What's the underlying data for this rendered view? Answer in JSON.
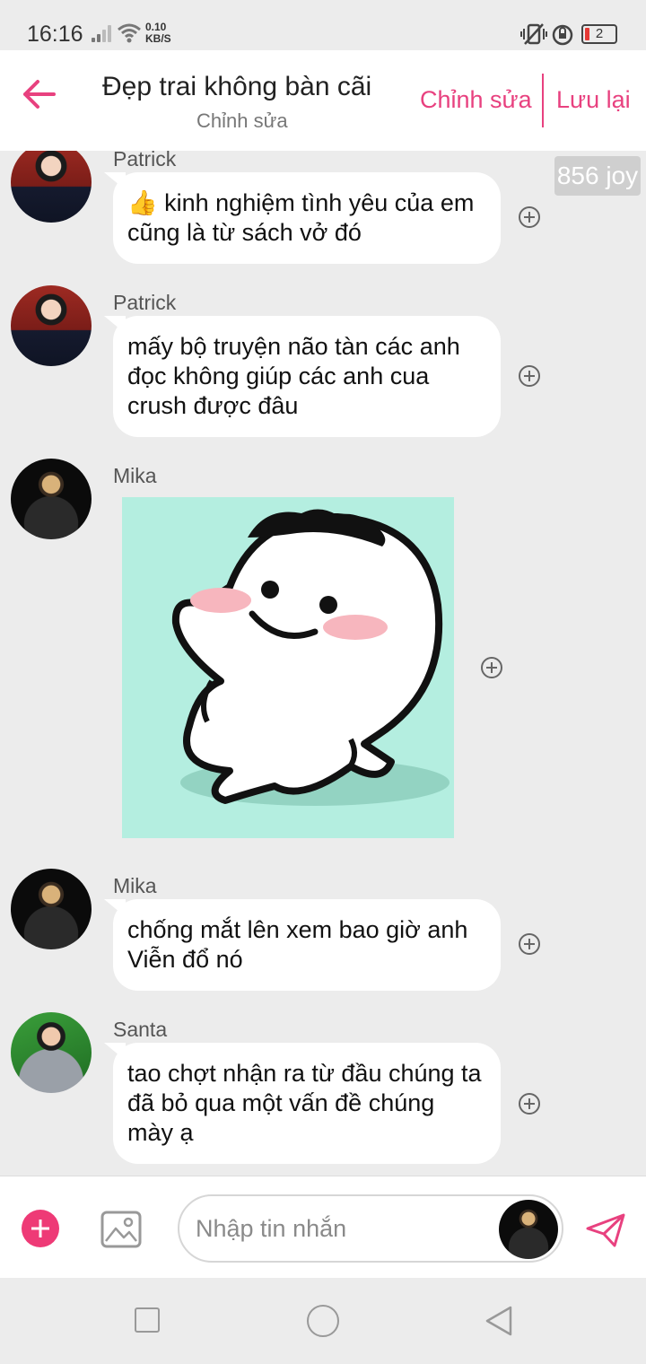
{
  "status_bar": {
    "time": "16:16",
    "net_speed_value": "0.10",
    "net_speed_unit": "KB/S",
    "battery": "2"
  },
  "header": {
    "title": "Đẹp trai không bàn cãi",
    "subtitle": "Chỉnh sửa",
    "edit_label": "Chỉnh sửa",
    "save_label": "Lưu lại"
  },
  "joy_badge": "856 joy",
  "messages": [
    {
      "sender": "Patrick",
      "emoji": "👍",
      "text": " kinh nghiệm tình yêu của em cũng là từ sách vở đó"
    },
    {
      "sender": "Patrick",
      "text": "mấy bộ truyện não tàn các anh đọc không giúp các anh cua crush được đâu"
    },
    {
      "sender": "Mika",
      "type": "sticker"
    },
    {
      "sender": "Mika",
      "text": "chống mắt lên xem bao giờ anh Viễn đổ nó"
    },
    {
      "sender": "Santa",
      "text": " tao chợt nhận ra từ đầu chúng ta đã bỏ qua một vấn đề chúng mày ạ"
    }
  ],
  "input": {
    "placeholder": "Nhập tin nhắn"
  },
  "colors": {
    "accent": "#e8417f",
    "background": "#ececec",
    "bubble": "#ffffff",
    "sticker_bg": "#b4eee0"
  }
}
